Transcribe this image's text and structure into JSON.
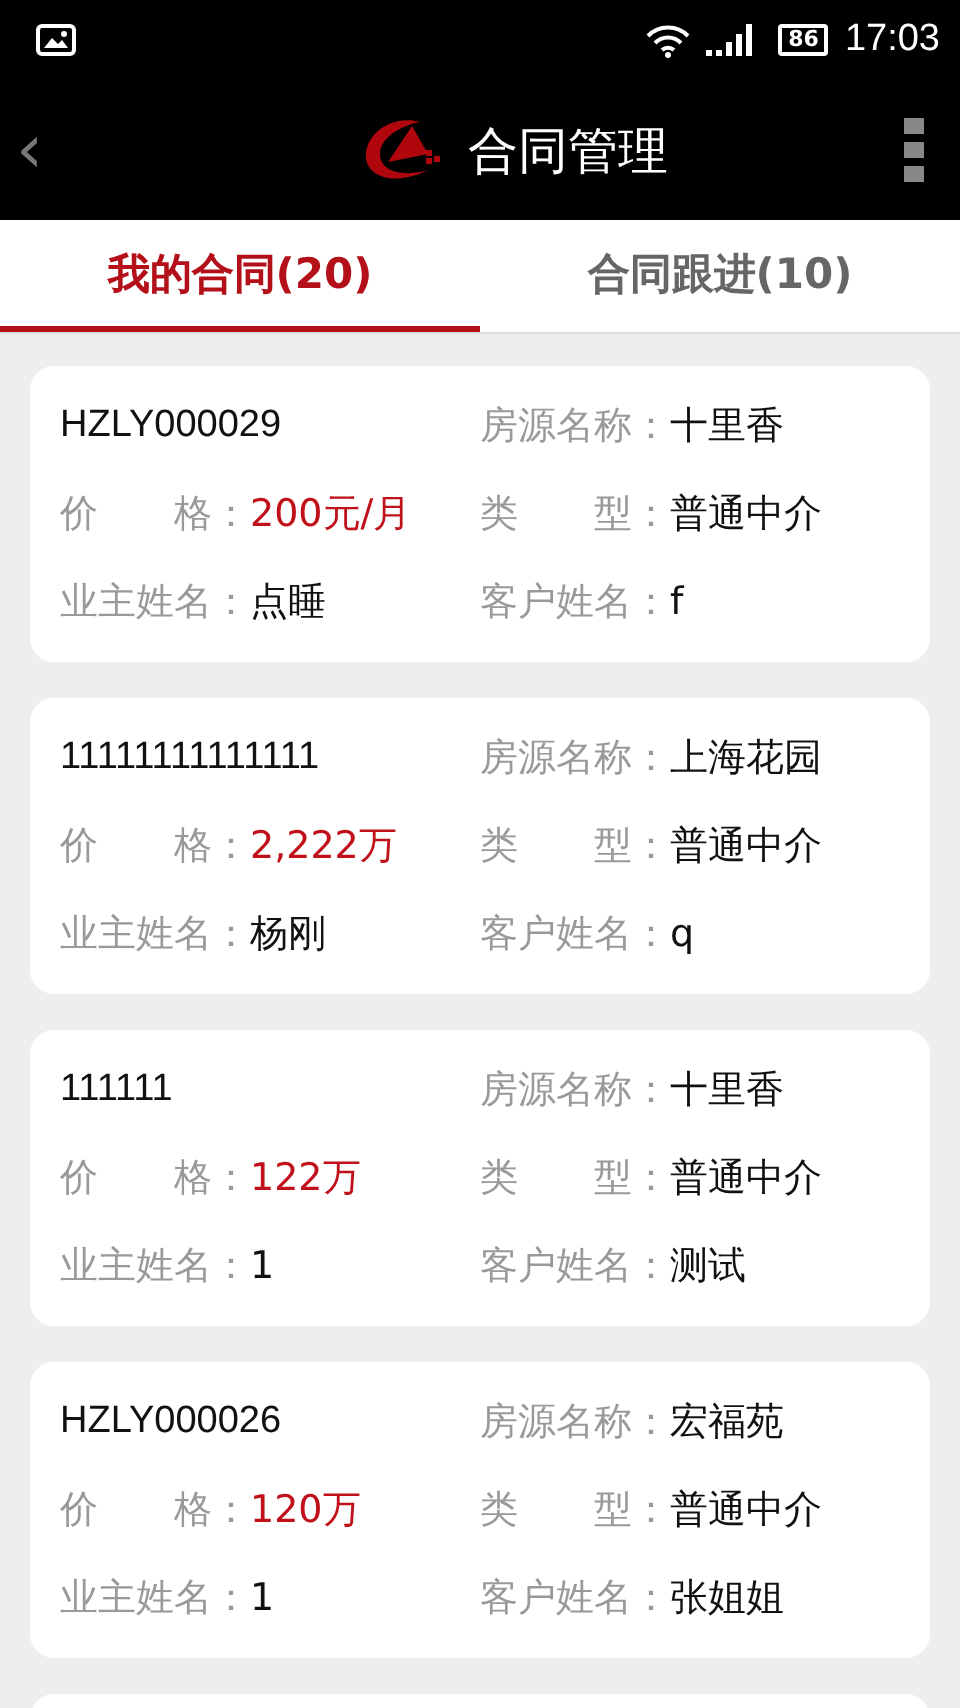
{
  "status_bar": {
    "battery": "86",
    "time": "17:03"
  },
  "header": {
    "title": "合同管理",
    "back": "‹"
  },
  "tabs": [
    {
      "label": "我的合同(20)",
      "selected": true
    },
    {
      "label": "合同跟进(10)",
      "selected": false
    }
  ],
  "contracts": [
    {
      "number": "HZLY000029",
      "fields": [
        {
          "label": "房源名称：",
          "value": "十里香",
          "kind": "plain"
        },
        {
          "label": "价　　格：",
          "value": "200元/月",
          "kind": "price"
        },
        {
          "label": "类　　型：",
          "value": "普通中介",
          "kind": "plain"
        },
        {
          "label": "业主姓名：",
          "value": "点睡",
          "kind": "plain"
        },
        {
          "label": "客户姓名：",
          "value": "f",
          "kind": "plain"
        }
      ]
    },
    {
      "number": "11111111111111",
      "fields": [
        {
          "label": "房源名称：",
          "value": "上海花园",
          "kind": "plain"
        },
        {
          "label": "价　　格：",
          "value": "2,222万",
          "kind": "price"
        },
        {
          "label": "类　　型：",
          "value": "普通中介",
          "kind": "plain"
        },
        {
          "label": "业主姓名：",
          "value": "杨刚",
          "kind": "plain"
        },
        {
          "label": "客户姓名：",
          "value": "q",
          "kind": "plain"
        }
      ]
    },
    {
      "number": "111111",
      "fields": [
        {
          "label": "房源名称：",
          "value": "十里香",
          "kind": "plain"
        },
        {
          "label": "价　　格：",
          "value": "122万",
          "kind": "price"
        },
        {
          "label": "类　　型：",
          "value": "普通中介",
          "kind": "plain"
        },
        {
          "label": "业主姓名：",
          "value": "1",
          "kind": "plain"
        },
        {
          "label": "客户姓名：",
          "value": "测试",
          "kind": "plain"
        }
      ]
    },
    {
      "number": "HZLY000026",
      "fields": [
        {
          "label": "房源名称：",
          "value": "宏福苑",
          "kind": "plain"
        },
        {
          "label": "价　　格：",
          "value": "120万",
          "kind": "price"
        },
        {
          "label": "类　　型：",
          "value": "普通中介",
          "kind": "plain"
        },
        {
          "label": "业主姓名：",
          "value": "1",
          "kind": "plain"
        },
        {
          "label": "客户姓名：",
          "value": "张姐姐",
          "kind": "plain"
        }
      ]
    }
  ]
}
